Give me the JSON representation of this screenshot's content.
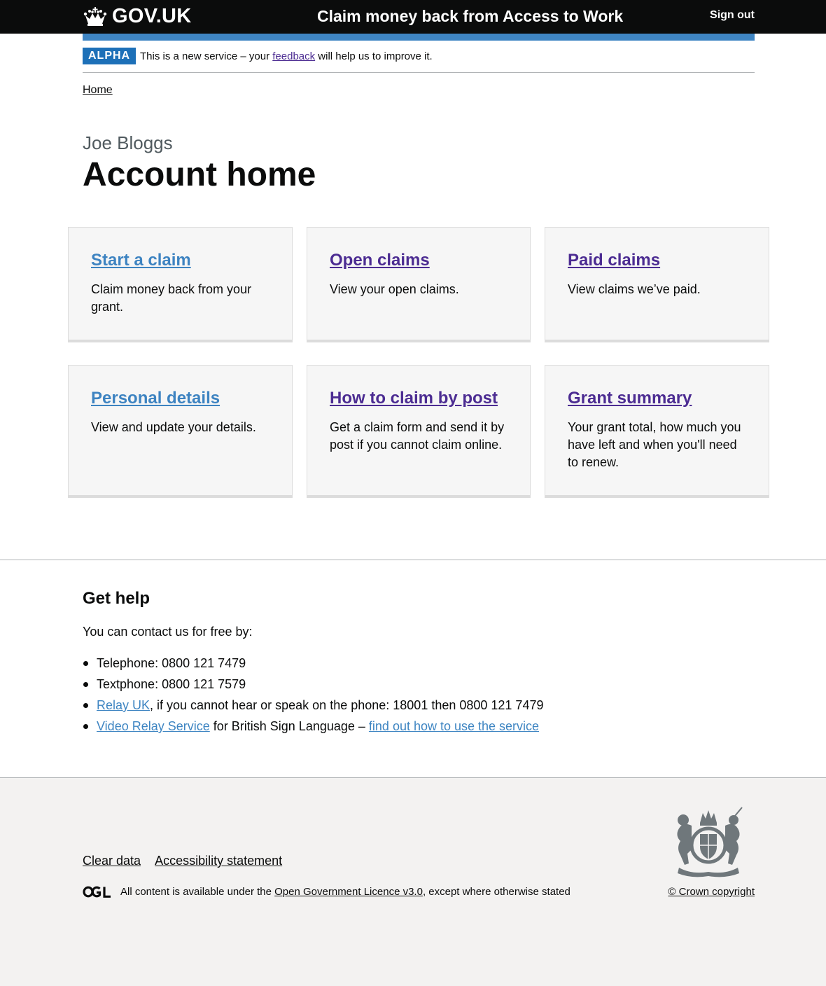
{
  "header": {
    "logo_text": "GOV.UK",
    "service_name": "Claim money back from Access to Work",
    "sign_out": "Sign out"
  },
  "phase_banner": {
    "tag": "ALPHA",
    "text_before": "This is a new service – your ",
    "link": "feedback",
    "text_after": " will help us to improve it."
  },
  "breadcrumb": {
    "home": "Home"
  },
  "page": {
    "caption": "Joe Bloggs",
    "title": "Account home"
  },
  "cards": [
    {
      "title": "Start a claim",
      "description": "Claim money back from your grant."
    },
    {
      "title": "Open claims",
      "description": "View your open claims."
    },
    {
      "title": "Paid claims",
      "description": "View claims we’ve paid."
    },
    {
      "title": "Personal details",
      "description": "View and update your details."
    },
    {
      "title": "How to claim by post",
      "description": "Get a claim form and send it by post if you cannot claim online."
    },
    {
      "title": "Grant summary",
      "description": "Your grant total, how much you have left and when you'll need to renew."
    }
  ],
  "help": {
    "title": "Get help",
    "intro": "You can contact us for free by:",
    "telephone": "Telephone: 0800 121 7479",
    "textphone": "Textphone: 0800 121 7579",
    "relay_link": "Relay UK",
    "relay_text": ", if you cannot hear or speak on the phone: 18001 then 0800 121 7479",
    "video_link": "Video Relay Service",
    "video_text": " for British Sign Language – ",
    "video_howto_link": "find out how to use the service"
  },
  "footer": {
    "clear_data": "Clear data",
    "accessibility": "Accessibility statement",
    "licence_before": "All content is available under the ",
    "licence_link": "Open Government Licence v3.0",
    "licence_after": ", except where otherwise stated",
    "crown_copyright": "© Crown copyright"
  },
  "colors": {
    "header_bg": "#0b0c0c",
    "link_blue": "#1d70b8",
    "link_visited": "#4c2c92",
    "footer_bg": "#f3f2f1",
    "card_bg": "#f6f6f6"
  },
  "icons": {
    "logo": "crown-icon",
    "ogl": "ogl-logo-icon",
    "crest": "royal-coat-of-arms-icon"
  }
}
